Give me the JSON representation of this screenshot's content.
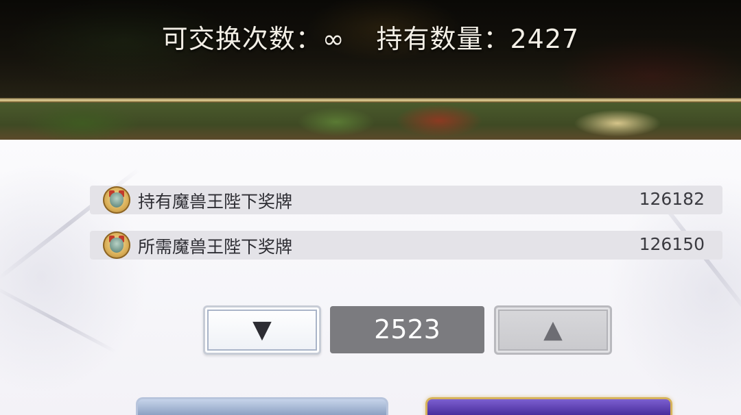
{
  "header": {
    "exchange_limit_label": "可交换次数：",
    "exchange_limit_value": "∞",
    "owned_count_label": "持有数量：",
    "owned_count_value": "2427"
  },
  "currency_rows": [
    {
      "icon": "demon-king-medal-icon",
      "label": "持有魔兽王陛下奖牌",
      "value": "126182"
    },
    {
      "icon": "demon-king-medal-icon",
      "label": "所需魔兽王陛下奖牌",
      "value": "126150"
    }
  ],
  "quantity_stepper": {
    "decrease_glyph": "▼",
    "increase_glyph": "▲",
    "value": "2523"
  }
}
